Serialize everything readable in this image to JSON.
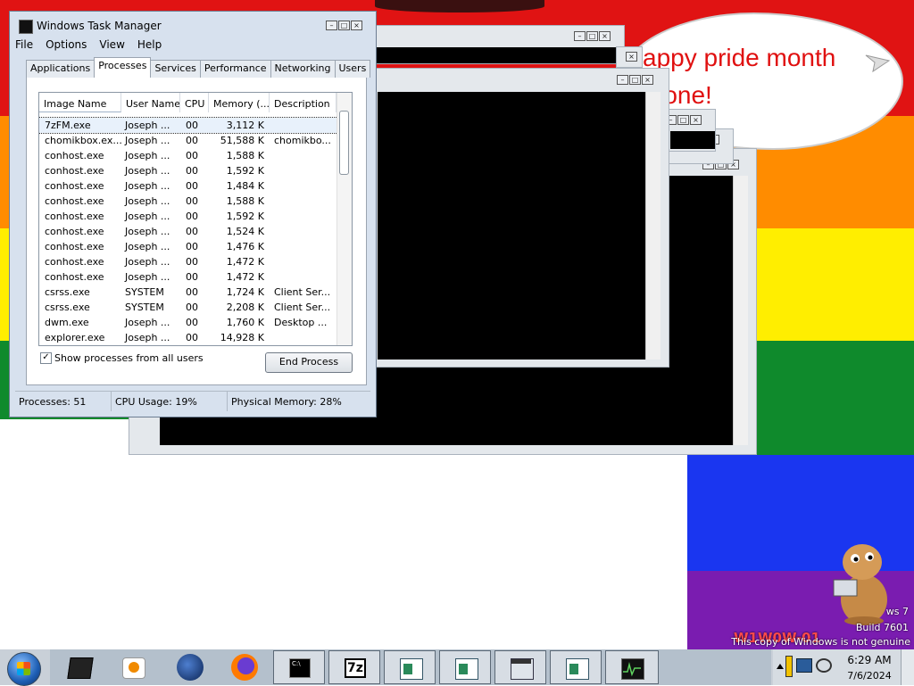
{
  "desktop": {
    "bubble_lines": [
      "appy pride month",
      "ryone!"
    ],
    "watermark": {
      "os_line": "ws 7",
      "build_line": "Build 7601",
      "genuine_line": "This copy of Windows is not genuine",
      "stamp": "W1W0W-01"
    },
    "colors": {
      "red": "#e01313",
      "orange": "#ff8c00",
      "yellow": "#ffee00",
      "green": "#0f8a2c",
      "blue": "#1a36f0",
      "purple": "#7a1cb0"
    }
  },
  "task_manager": {
    "title": "Windows Task Manager",
    "menu": [
      "File",
      "Options",
      "View",
      "Help"
    ],
    "tabs": [
      "Applications",
      "Processes",
      "Services",
      "Performance",
      "Networking",
      "Users"
    ],
    "selected_tab": "Processes",
    "columns": [
      "Image Name",
      "User Name",
      "CPU",
      "Memory (...",
      "Description"
    ],
    "rows": [
      [
        "7zFM.exe",
        "Joseph ...",
        "00",
        "3,112 K",
        ""
      ],
      [
        "chomikbox.ex...",
        "Joseph ...",
        "00",
        "51,588 K",
        "chomikbo..."
      ],
      [
        "conhost.exe",
        "Joseph ...",
        "00",
        "1,588 K",
        ""
      ],
      [
        "conhost.exe",
        "Joseph ...",
        "00",
        "1,592 K",
        ""
      ],
      [
        "conhost.exe",
        "Joseph ...",
        "00",
        "1,484 K",
        ""
      ],
      [
        "conhost.exe",
        "Joseph ...",
        "00",
        "1,588 K",
        ""
      ],
      [
        "conhost.exe",
        "Joseph ...",
        "00",
        "1,592 K",
        ""
      ],
      [
        "conhost.exe",
        "Joseph ...",
        "00",
        "1,524 K",
        ""
      ],
      [
        "conhost.exe",
        "Joseph ...",
        "00",
        "1,476 K",
        ""
      ],
      [
        "conhost.exe",
        "Joseph ...",
        "00",
        "1,472 K",
        ""
      ],
      [
        "conhost.exe",
        "Joseph ...",
        "00",
        "1,472 K",
        ""
      ],
      [
        "csrss.exe",
        "SYSTEM",
        "00",
        "1,724 K",
        "Client Ser..."
      ],
      [
        "csrss.exe",
        "SYSTEM",
        "00",
        "2,208 K",
        "Client Ser..."
      ],
      [
        "dwm.exe",
        "Joseph ...",
        "00",
        "1,760 K",
        "Desktop ..."
      ],
      [
        "explorer.exe",
        "Joseph ...",
        "00",
        "14,928 K",
        ""
      ]
    ],
    "show_all_label": "Show processes from all users",
    "show_all_checked": true,
    "end_process_label": "End Process",
    "status": {
      "processes": "Processes: 51",
      "cpu": "CPU Usage: 19%",
      "memory": "Physical Memory: 28%"
    }
  },
  "taskbar": {
    "items": [
      "task-manager",
      "media-player",
      "globe",
      "firefox",
      "cmd",
      "7-zip",
      "window",
      "window",
      "explorer",
      "window",
      "resource-monitor"
    ],
    "clock_time": "6:29 AM",
    "clock_date": "7/6/2024"
  }
}
